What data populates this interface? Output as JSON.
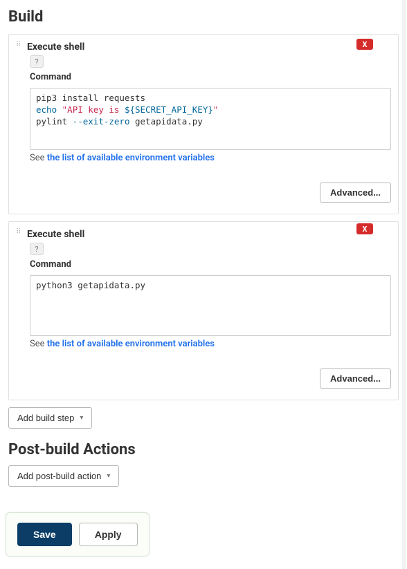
{
  "section_build_title": "Build",
  "section_postbuild_title": "Post-build Actions",
  "steps": [
    {
      "title": "Execute shell",
      "help_label": "?",
      "delete_label": "X",
      "command_label": "Command",
      "command_lines": [
        {
          "plain": "pip3 install requests"
        },
        {
          "tokens": [
            {
              "t": "echo",
              "cls": "tok-kw"
            },
            {
              "t": " "
            },
            {
              "t": "\"API key is ",
              "cls": "tok-str"
            },
            {
              "t": "${SECRET_API_KEY}",
              "cls": "tok-var"
            },
            {
              "t": "\"",
              "cls": "tok-str"
            }
          ]
        },
        {
          "tokens": [
            {
              "t": "pylint "
            },
            {
              "t": "--exit-zero",
              "cls": "tok-opt"
            },
            {
              "t": " getapidata.py"
            }
          ]
        }
      ],
      "hint_prefix": "See ",
      "hint_link": "the list of available environment variables",
      "advanced_label": "Advanced..."
    },
    {
      "title": "Execute shell",
      "help_label": "?",
      "delete_label": "X",
      "command_label": "Command",
      "command_lines": [
        {
          "plain": "python3 getapidata.py"
        }
      ],
      "hint_prefix": "See ",
      "hint_link": "the list of available environment variables",
      "advanced_label": "Advanced..."
    }
  ],
  "add_build_step_label": "Add build step",
  "add_postbuild_action_label": "Add post-build action",
  "footer": {
    "save_label": "Save",
    "apply_label": "Apply"
  }
}
